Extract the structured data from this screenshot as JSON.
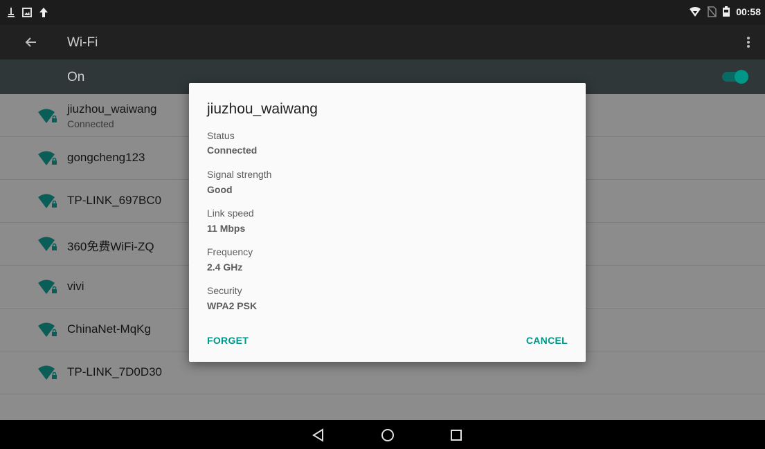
{
  "status_bar": {
    "time": "00:58",
    "left_icons": [
      "usb-debug-icon",
      "screenshot-icon",
      "upload-icon"
    ],
    "right_icons": [
      "wifi-signal-icon",
      "no-sim-icon",
      "battery-icon"
    ]
  },
  "toolbar": {
    "title": "Wi-Fi",
    "back_icon": "arrow-back-icon",
    "menu_icon": "more-vert-icon"
  },
  "wifi_toggle": {
    "label": "On",
    "state": true,
    "accent_color": "#009688"
  },
  "networks": [
    {
      "ssid": "jiuzhou_waiwang",
      "status": "Connected"
    },
    {
      "ssid": "gongcheng123",
      "status": ""
    },
    {
      "ssid": "TP-LINK_697BC0",
      "status": ""
    },
    {
      "ssid": "360免费WiFi-ZQ",
      "status": ""
    },
    {
      "ssid": "vivi",
      "status": ""
    },
    {
      "ssid": "ChinaNet-MqKg",
      "status": ""
    },
    {
      "ssid": "TP-LINK_7D0D30",
      "status": ""
    }
  ],
  "dialog": {
    "title": "jiuzhou_waiwang",
    "fields": [
      {
        "label": "Status",
        "value": "Connected"
      },
      {
        "label": "Signal strength",
        "value": "Good"
      },
      {
        "label": "Link speed",
        "value": "11 Mbps"
      },
      {
        "label": "Frequency",
        "value": "2.4 GHz"
      },
      {
        "label": "Security",
        "value": "WPA2 PSK"
      }
    ],
    "forget_label": "FORGET",
    "cancel_label": "CANCEL"
  },
  "nav_bar": {
    "buttons": [
      "back-triangle-icon",
      "home-circle-icon",
      "recents-square-icon"
    ]
  }
}
